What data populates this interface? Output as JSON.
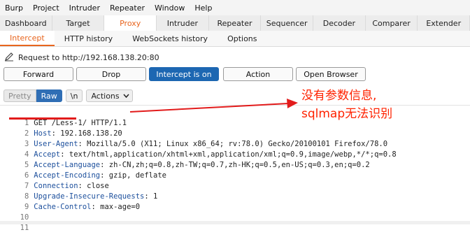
{
  "menubar": {
    "items": [
      "Burp",
      "Project",
      "Intruder",
      "Repeater",
      "Window",
      "Help"
    ]
  },
  "main_tabs": [
    "Dashboard",
    "Target",
    "Proxy",
    "Intruder",
    "Repeater",
    "Sequencer",
    "Decoder",
    "Comparer",
    "Extender"
  ],
  "proxy_tabs": [
    "Intercept",
    "HTTP history",
    "WebSockets history",
    "Options"
  ],
  "request_to": "Request to http://192.168.138.20:80",
  "buttons": {
    "forward": "Forward",
    "drop": "Drop",
    "intercept": "Intercept is on",
    "action": "Action",
    "open_browser": "Open Browser"
  },
  "toolbar": {
    "pretty": "Pretty",
    "raw": "Raw",
    "newline": "\\n",
    "actions": "Actions"
  },
  "request": {
    "line1": {
      "num": "1",
      "text": "GET /Less-1/ HTTP/1.1"
    },
    "headers": [
      {
        "num": "2",
        "key": "Host",
        "val": "192.168.138.20"
      },
      {
        "num": "3",
        "key": "User-Agent",
        "val": "Mozilla/5.0 (X11; Linux x86_64; rv:78.0) Gecko/20100101 Firefox/78.0"
      },
      {
        "num": "4",
        "key": "Accept",
        "val": "text/html,application/xhtml+xml,application/xml;q=0.9,image/webp,*/*;q=0.8"
      },
      {
        "num": "5",
        "key": "Accept-Language",
        "val": "zh-CN,zh;q=0.8,zh-TW;q=0.7,zh-HK;q=0.5,en-US;q=0.3,en;q=0.2"
      },
      {
        "num": "6",
        "key": "Accept-Encoding",
        "val": "gzip, deflate"
      },
      {
        "num": "7",
        "key": "Connection",
        "val": "close"
      },
      {
        "num": "8",
        "key": "Upgrade-Insecure-Requests",
        "val": "1"
      },
      {
        "num": "9",
        "key": "Cache-Control",
        "val": "max-age=0"
      }
    ],
    "empty_lines": [
      "10",
      "11"
    ]
  },
  "annotation": {
    "line1": "没有参数信息,",
    "line2": "sqlmap无法识别",
    "color": "#ff2200"
  },
  "colors": {
    "accent": "#e8651e",
    "intercept_on": "#1d67b2",
    "header_key": "#1c4f9c"
  }
}
